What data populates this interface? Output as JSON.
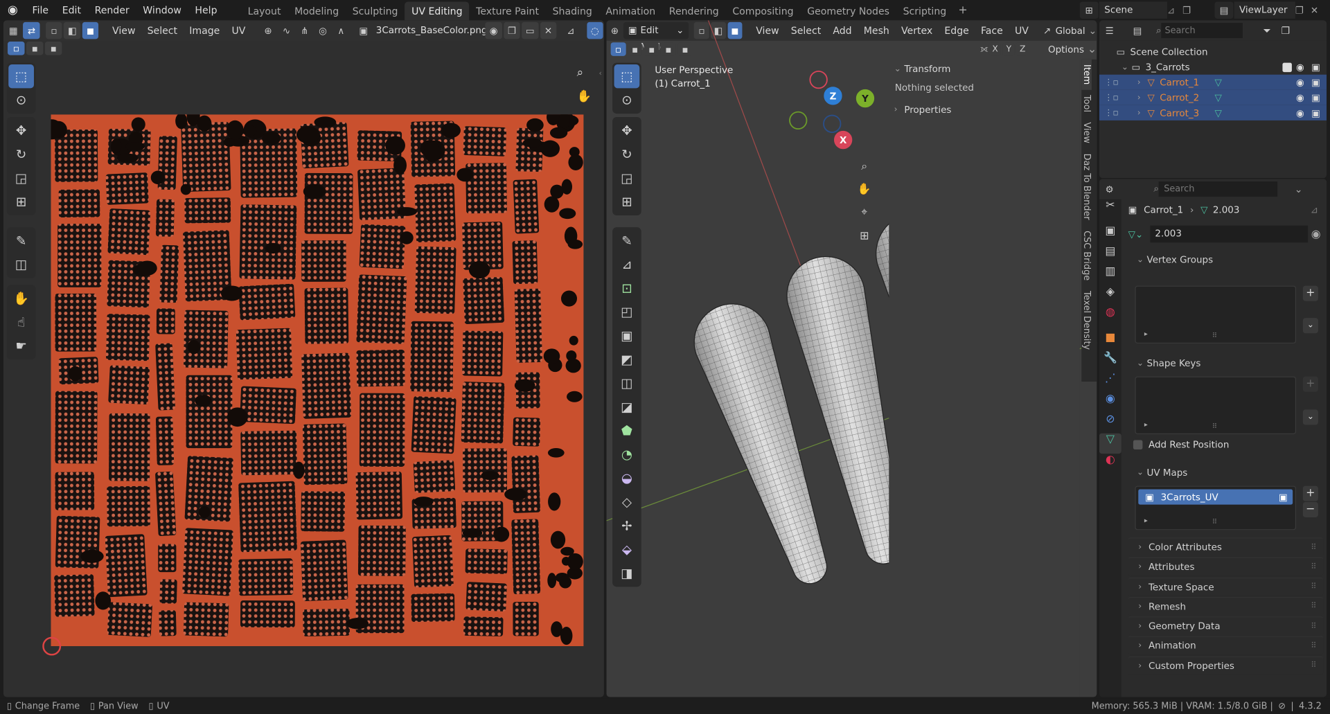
{
  "topbar": {
    "menus": [
      "File",
      "Edit",
      "Render",
      "Window",
      "Help"
    ],
    "workspaces": [
      "Layout",
      "Modeling",
      "Sculpting",
      "UV Editing",
      "Texture Paint",
      "Shading",
      "Animation",
      "Rendering",
      "Compositing",
      "Geometry Nodes",
      "Scripting"
    ],
    "active_workspace": "UV Editing",
    "scene": "Scene",
    "view_layer": "ViewLayer",
    "search_placeholder": "Search"
  },
  "uv_editor": {
    "menus": [
      "View",
      "Select",
      "Image",
      "UV"
    ],
    "image_name": "3Carrots_BaseColor.png",
    "texture_color": "#c9502e"
  },
  "viewport": {
    "mode": "Edit Mode",
    "menus": [
      "View",
      "Select",
      "Add",
      "Mesh",
      "Vertex",
      "Edge",
      "Face",
      "UV"
    ],
    "orientation": "Global",
    "options_label": "Options",
    "axis_labels": [
      "X",
      "Y",
      "Z"
    ],
    "perspective": "User Perspective",
    "object_label": "(1) Carrot_1",
    "n_panel": {
      "transform": "Transform",
      "nothing_selected": "Nothing selected",
      "properties": "Properties",
      "tabs": [
        "Item",
        "Tool",
        "View",
        "Daz To Blender",
        "CSC Bridge",
        "Texel Density"
      ]
    }
  },
  "outliner": {
    "root": "Scene Collection",
    "collection": "3_Carrots",
    "objects": [
      "Carrot_1",
      "Carrot_2",
      "Carrot_3"
    ]
  },
  "properties": {
    "search_placeholder": "Search",
    "breadcrumb_object": "Carrot_1",
    "breadcrumb_mesh": "2.003",
    "mesh_name": "2.003",
    "vertex_groups": "Vertex Groups",
    "shape_keys": "Shape Keys",
    "add_rest_position": "Add Rest Position",
    "uv_maps": "UV Maps",
    "uv_map_name": "3Carrots_UV",
    "collapsed_panels": [
      "Color Attributes",
      "Attributes",
      "Texture Space",
      "Remesh",
      "Geometry Data",
      "Animation",
      "Custom Properties"
    ]
  },
  "statusbar": {
    "change_frame": "Change Frame",
    "pan_view": "Pan View",
    "uv": "UV",
    "memory": "Memory: 565.3 MiB | VRAM: 1.5/8.0 GiB |",
    "version": "4.3.2"
  },
  "colors": {
    "accent": "#4772b3",
    "object_orange": "#e8883a",
    "mesh_green": "#4cc0a0"
  }
}
